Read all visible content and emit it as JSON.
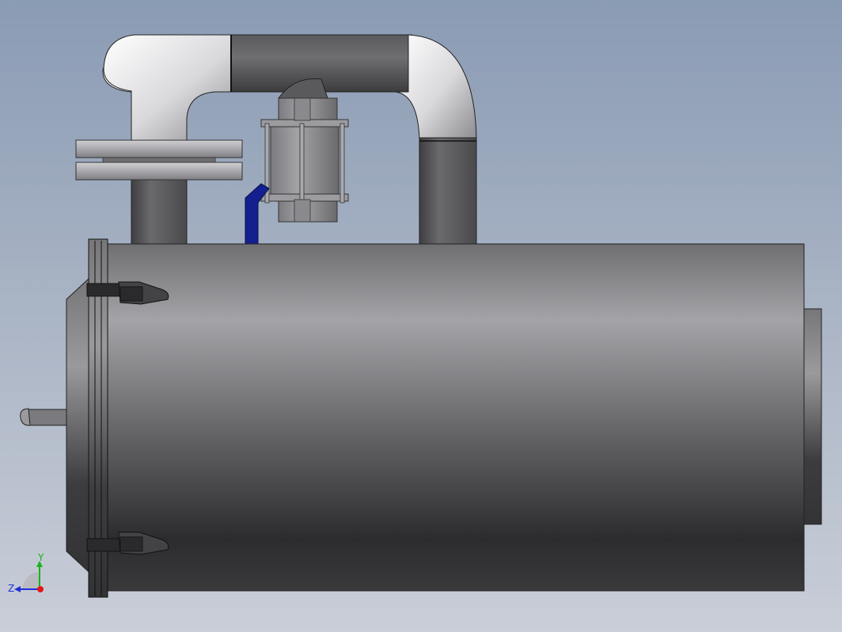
{
  "triad": {
    "y_label": "Y",
    "z_label": "Z",
    "colors": {
      "y": "#19b219",
      "z": "#1f2fd6",
      "x": "#e01818"
    }
  },
  "model": {
    "tank_color": "#5a5a5e",
    "pipe_color": "#5c5c60",
    "valve_color": "#8e8e92",
    "handle_color": "#13208e"
  }
}
